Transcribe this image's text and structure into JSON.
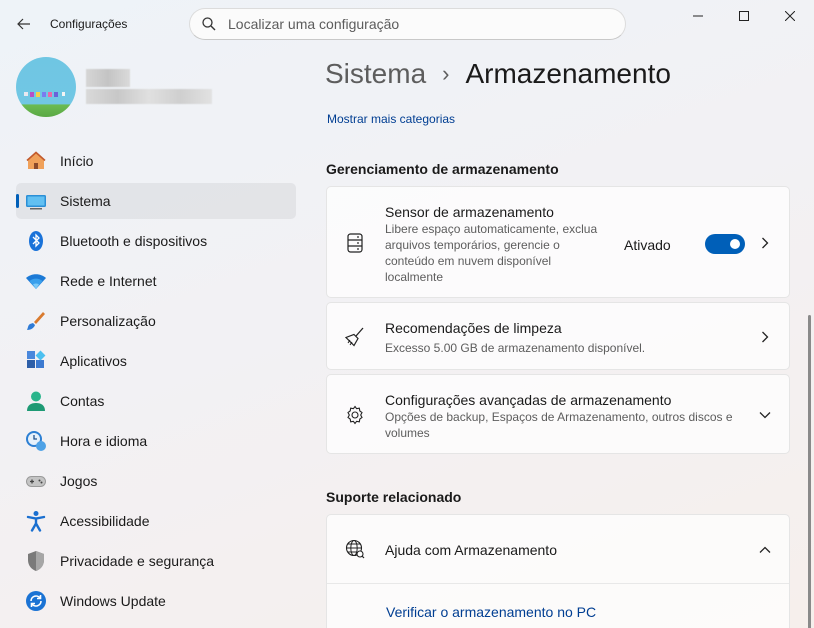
{
  "app": {
    "title": "Configurações"
  },
  "search": {
    "placeholder": "Localizar uma configuração"
  },
  "sidebar": {
    "items": [
      {
        "label": "Início",
        "icon": "home-icon"
      },
      {
        "label": "Sistema",
        "icon": "system-icon",
        "active": true
      },
      {
        "label": "Bluetooth e dispositivos",
        "icon": "bluetooth-icon"
      },
      {
        "label": "Rede e Internet",
        "icon": "wifi-icon"
      },
      {
        "label": "Personalização",
        "icon": "brush-icon"
      },
      {
        "label": "Aplicativos",
        "icon": "apps-icon"
      },
      {
        "label": "Contas",
        "icon": "account-icon"
      },
      {
        "label": "Hora e idioma",
        "icon": "time-language-icon"
      },
      {
        "label": "Jogos",
        "icon": "gamepad-icon"
      },
      {
        "label": "Acessibilidade",
        "icon": "accessibility-icon"
      },
      {
        "label": "Privacidade e segurança",
        "icon": "shield-icon"
      },
      {
        "label": "Windows Update",
        "icon": "update-icon"
      }
    ]
  },
  "header": {
    "parent": "Sistema",
    "separator": "›",
    "current": "Armazenamento"
  },
  "main": {
    "more_link": "Mostrar mais categorias",
    "management_title": "Gerenciamento de armazenamento",
    "storage_sense": {
      "title": "Sensor de armazenamento",
      "description": "Libere espaço automaticamente, exclua arquivos temporários, gerencie o conteúdo em nuvem disponível localmente",
      "toggle_label": "Ativado",
      "toggle_on": true
    },
    "cleanup": {
      "title": "Recomendações de limpeza",
      "description": "Excesso 5.00 GB de armazenamento disponível."
    },
    "advanced": {
      "title": "Configurações avançadas de armazenamento",
      "description": "Opções de backup, Espaços de Armazenamento, outros discos e volumes"
    },
    "support_title": "Suporte relacionado",
    "help": {
      "title": "Ajuda com Armazenamento",
      "link": "Verificar o armazenamento no PC"
    }
  },
  "colors": {
    "accent": "#005fb8",
    "link": "#003e92"
  }
}
